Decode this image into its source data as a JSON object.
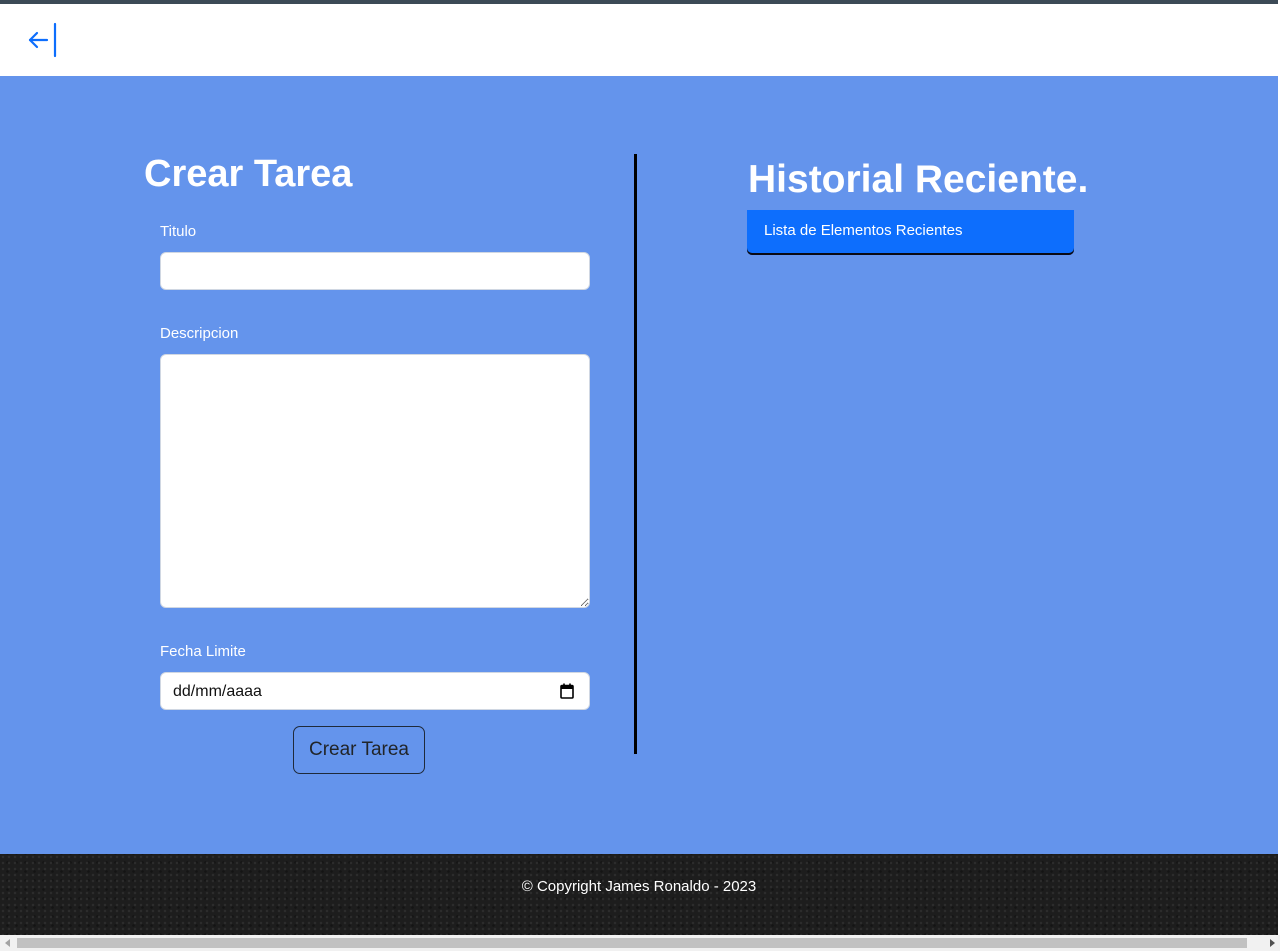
{
  "nav": {
    "back_icon": "arrow-left-to-line-icon"
  },
  "form": {
    "title": "Crear Tarea",
    "titulo_label": "Titulo",
    "titulo_value": "",
    "descripcion_label": "Descripcion",
    "descripcion_value": "",
    "fecha_label": "Fecha Limite",
    "fecha_placeholder": "dd/mm/aaaa",
    "calendar_icon": "calendar-icon",
    "submit_label": "Crear Tarea"
  },
  "history": {
    "title": "Historial Reciente.",
    "items": [
      {
        "label": "Lista de Elementos Recientes"
      }
    ]
  },
  "footer": {
    "copyright": "© Copyright James Ronaldo - 2023"
  },
  "colors": {
    "background": "#6494ec",
    "accent": "#0d6efd",
    "navbar": "#ffffff",
    "footer": "#1d1d1d",
    "divider": "#000000"
  }
}
